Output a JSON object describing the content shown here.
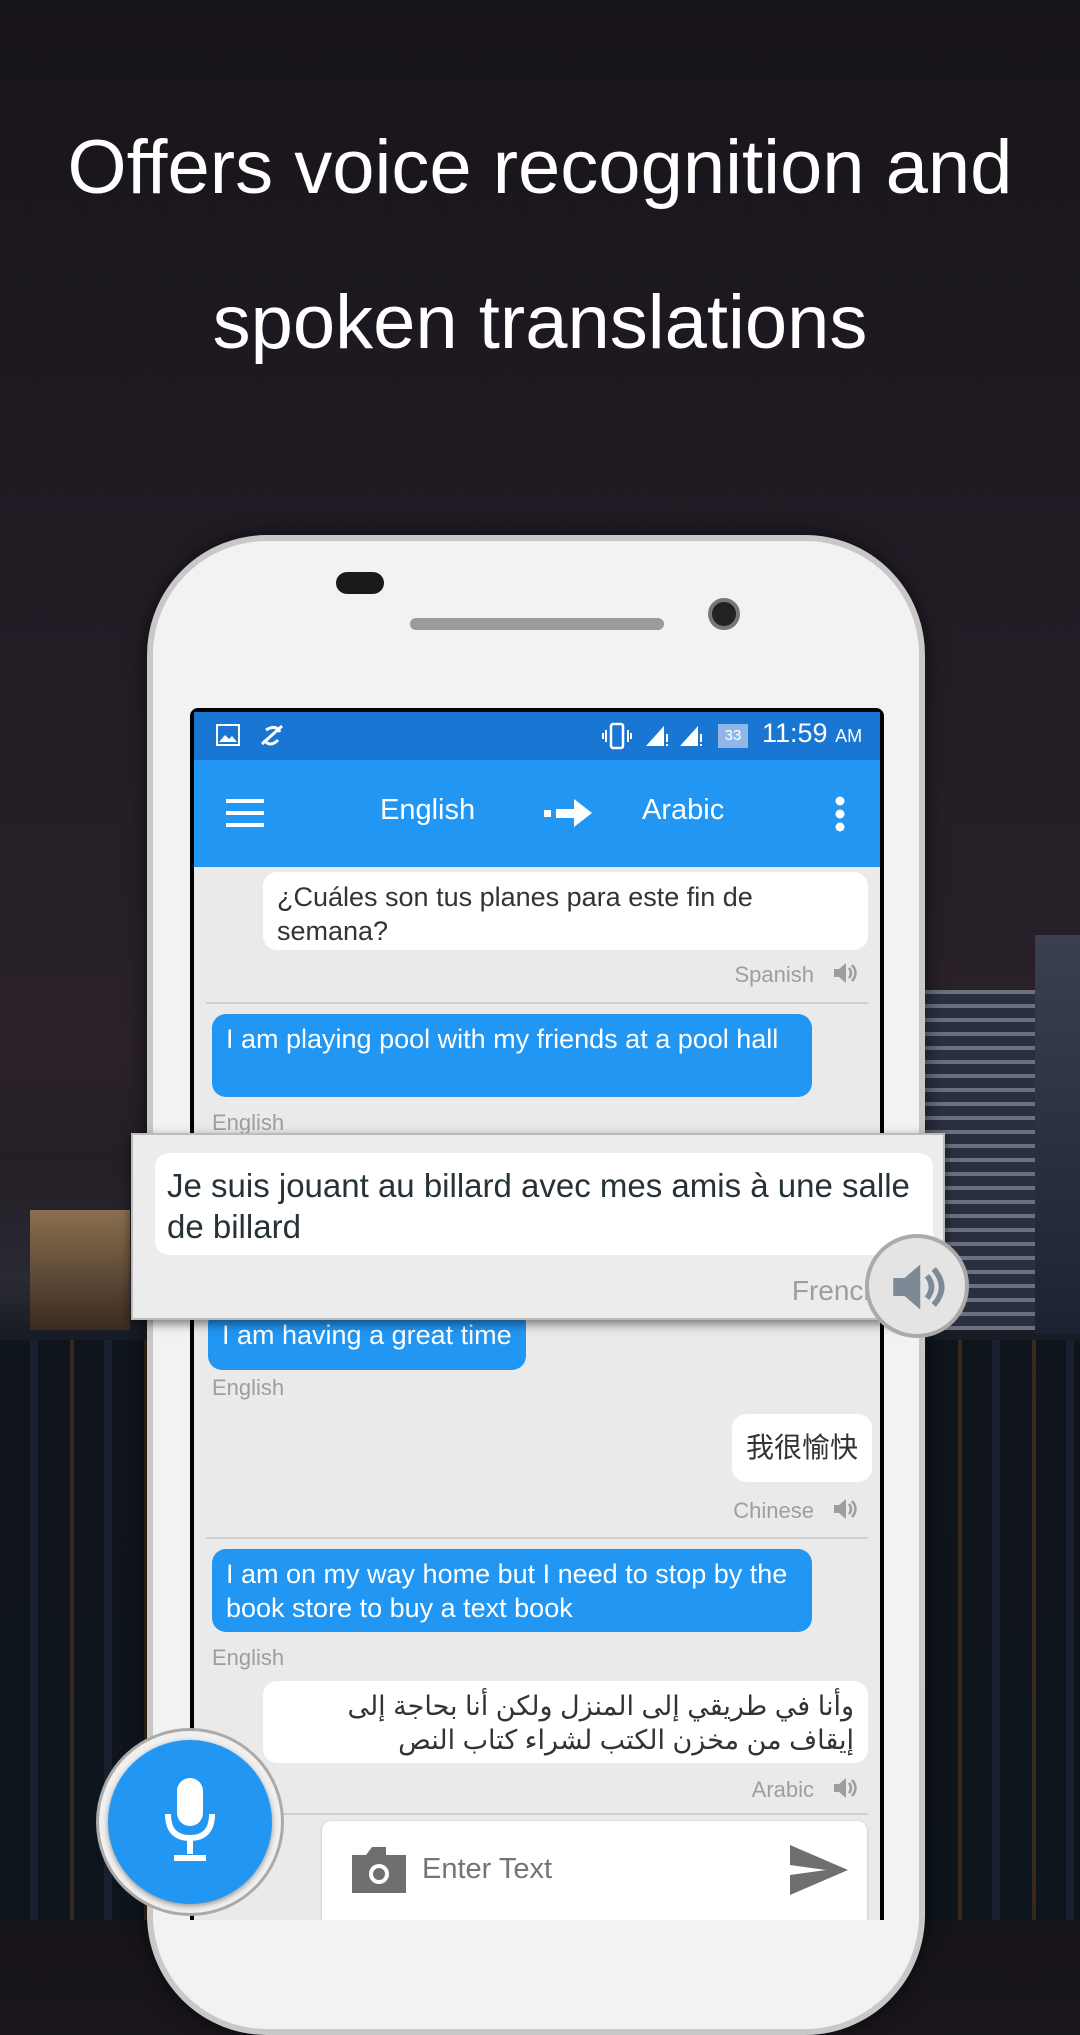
{
  "headline": {
    "line1": "Offers voice recognition and",
    "line2": "spoken translations"
  },
  "status_bar": {
    "time": "11:59",
    "ampm": "AM",
    "battery": "33",
    "icons": [
      "image-icon",
      "no-sync-icon",
      "vibrate-icon",
      "signal-icon",
      "signal-icon",
      "battery-icon"
    ]
  },
  "toolbar": {
    "source_language": "English",
    "target_language": "Arabic",
    "icons": [
      "menu-icon",
      "arrow-right-icon",
      "more-vert-icon"
    ]
  },
  "messages": [
    {
      "text": "¿Cuáles son tus planes para este fin de semana?",
      "language": "Spanish",
      "side": "right"
    },
    {
      "text": "I am playing pool with my friends at a pool hall",
      "language": "English",
      "side": "left"
    },
    {
      "text": "I am having a great time",
      "language": "English",
      "side": "left"
    },
    {
      "text": "我很愉快",
      "language": "Chinese",
      "side": "right"
    },
    {
      "text": "I am on my way home but I need to stop by the book store to buy a text book",
      "language": "English",
      "side": "left"
    },
    {
      "text": "وأنا في طريقي إلى المنزل ولكن أنا بحاجة إلى إيقاف من مخزن الكتب لشراء كتاب النص",
      "language": "Arabic",
      "side": "right"
    }
  ],
  "highlight": {
    "text": "Je suis jouant au billard avec mes amis à une salle de billard",
    "language": "French"
  },
  "input": {
    "placeholder": "Enter Text"
  },
  "colors": {
    "primary": "#2196f3",
    "status": "#1976d2",
    "chat_bg": "#eaeaea"
  }
}
